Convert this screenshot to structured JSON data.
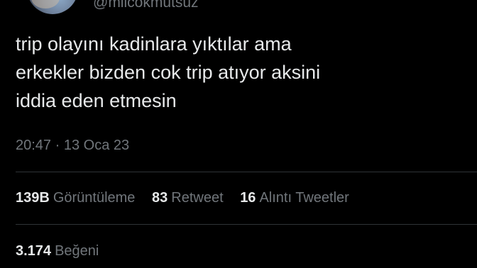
{
  "author": {
    "handle": "@milcokmutsuz"
  },
  "tweet": {
    "lines": [
      "trip olayını kadinlara yıktılar ama",
      "erkekler bizden cok trip atıyor aksini",
      "iddia eden etmesin"
    ],
    "time": "20:47",
    "separator": "·",
    "date": "13 Oca 23"
  },
  "stats": {
    "views": {
      "value": "139B",
      "label": "Görüntüleme"
    },
    "retweets": {
      "value": "83",
      "label": "Retweet"
    },
    "quotes": {
      "value": "16",
      "label": "Alıntı Tweetler"
    },
    "likes": {
      "value": "3.174",
      "label": "Beğeni"
    }
  },
  "colors": {
    "background": "#000000",
    "text_primary": "#e7e9ea",
    "text_secondary": "#71767b",
    "divider": "#2f3336"
  }
}
